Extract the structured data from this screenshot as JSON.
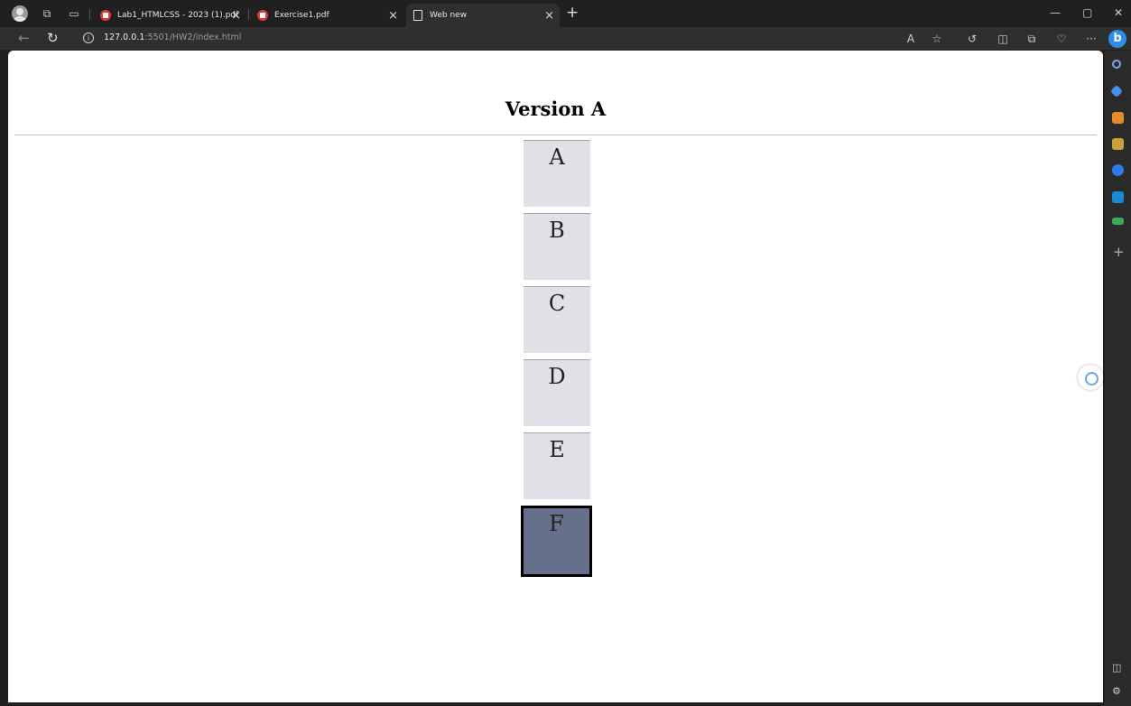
{
  "browser": {
    "tabs": [
      {
        "title": "Lab1_HTMLCSS - 2023 (1).pdf",
        "close": "×"
      },
      {
        "title": "Exercise1.pdf",
        "close": "×"
      },
      {
        "title": "Web new",
        "close": "×"
      }
    ],
    "new_tab": "+",
    "window_controls": {
      "minimize": "—",
      "maximize": "▢",
      "close": "✕"
    },
    "address": {
      "host": "127.0.0.1",
      "rest": ":5501/HW2/index.html"
    },
    "toolbar_icons": [
      "read-aloud-icon",
      "favorite-star-icon",
      "extensions-icon",
      "split-screen-icon",
      "collections-icon",
      "browser-essentials-icon",
      "more-icon",
      "bing-copilot-icon"
    ]
  },
  "page": {
    "heading": "Version A",
    "boxes": [
      {
        "label": "A",
        "selected": false
      },
      {
        "label": "B",
        "selected": false
      },
      {
        "label": "C",
        "selected": false
      },
      {
        "label": "D",
        "selected": false
      },
      {
        "label": "E",
        "selected": false
      },
      {
        "label": "F",
        "selected": true
      }
    ]
  },
  "sidebar": {
    "icons": [
      "search-icon",
      "shopping-tag-icon",
      "tools-icon",
      "people-icon",
      "office-icon",
      "outlook-icon",
      "drop-icon"
    ],
    "add": "+",
    "colors": [
      "#7aa7f0",
      "#4a8df0",
      "#e58a2a",
      "#c9a23c",
      "#2d7ae8",
      "#1a8ad6",
      "#3aa95a"
    ]
  },
  "colors": {
    "box_default": "#e0e0e6",
    "box_selected": "#66708b",
    "chrome_dark": "#202020"
  }
}
